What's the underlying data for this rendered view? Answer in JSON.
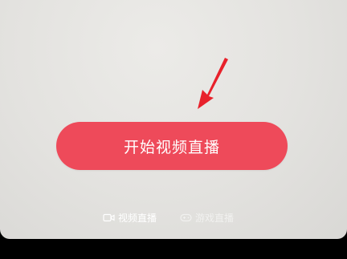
{
  "live": {
    "start_button_label": "开始视频直播",
    "modes": [
      {
        "label": "视频直播",
        "icon": "camera-icon",
        "selected": true
      },
      {
        "label": "游戏直播",
        "icon": "gamepad-icon",
        "selected": false
      }
    ]
  },
  "colors": {
    "accent": "#ee4a5a",
    "arrow": "#e8212b",
    "background": "#e3e2df"
  }
}
